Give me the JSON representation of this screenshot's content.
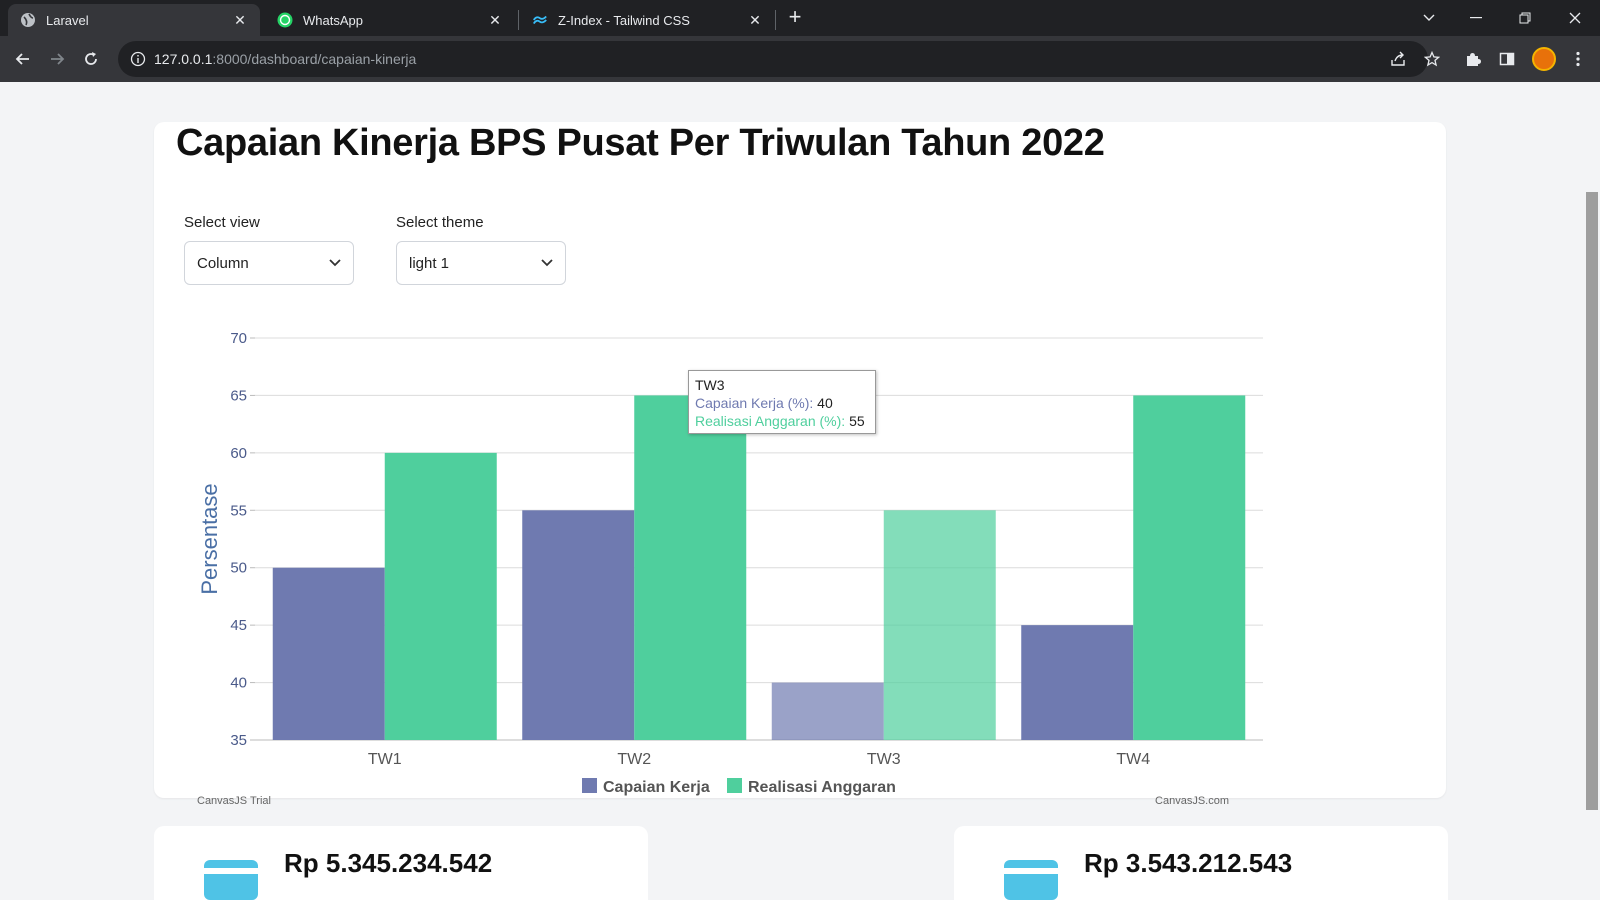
{
  "browser": {
    "tabs": [
      {
        "title": "Laravel",
        "icon": "globe-icon",
        "active": true
      },
      {
        "title": "WhatsApp",
        "icon": "whatsapp-icon",
        "active": false
      },
      {
        "title": "Z-Index - Tailwind CSS",
        "icon": "tailwind-icon",
        "active": false
      }
    ],
    "url_host": "127.0.0.1",
    "url_rest": ":8000/dashboard/capaian-kinerja"
  },
  "page": {
    "title": "Capaian Kinerja BPS Pusat Per Triwulan Tahun 2022",
    "view_label": "Select view",
    "view_value": "Column",
    "theme_label": "Select theme",
    "theme_value": "light 1"
  },
  "tooltip": {
    "title": "TW3",
    "line1_label": "Capaian Kerja (%):",
    "line1_value": "40",
    "line2_label": "Realisasi Anggaran (%):",
    "line2_value": "55"
  },
  "stats": [
    {
      "value": "Rp 5.345.234.542"
    },
    {
      "value": "Rp 3.543.212.543"
    }
  ],
  "chart_data": {
    "type": "bar",
    "categories": [
      "TW1",
      "TW2",
      "TW3",
      "TW4"
    ],
    "series": [
      {
        "name": "Capaian Kerja",
        "values": [
          50,
          55,
          40,
          45
        ],
        "color": "#6f7ab0"
      },
      {
        "name": "Realisasi Anggaran",
        "values": [
          60,
          65,
          55,
          65
        ],
        "color": "#4fcf9d"
      }
    ],
    "ylabel": "Persentase",
    "ylim": [
      35,
      70
    ],
    "yticks": [
      35,
      40,
      45,
      50,
      55,
      60,
      65,
      70
    ],
    "highlighted_category": "TW3",
    "grid": true,
    "legend_position": "bottom",
    "credit_left": "CanvasJS Trial",
    "credit_right": "CanvasJS.com"
  }
}
